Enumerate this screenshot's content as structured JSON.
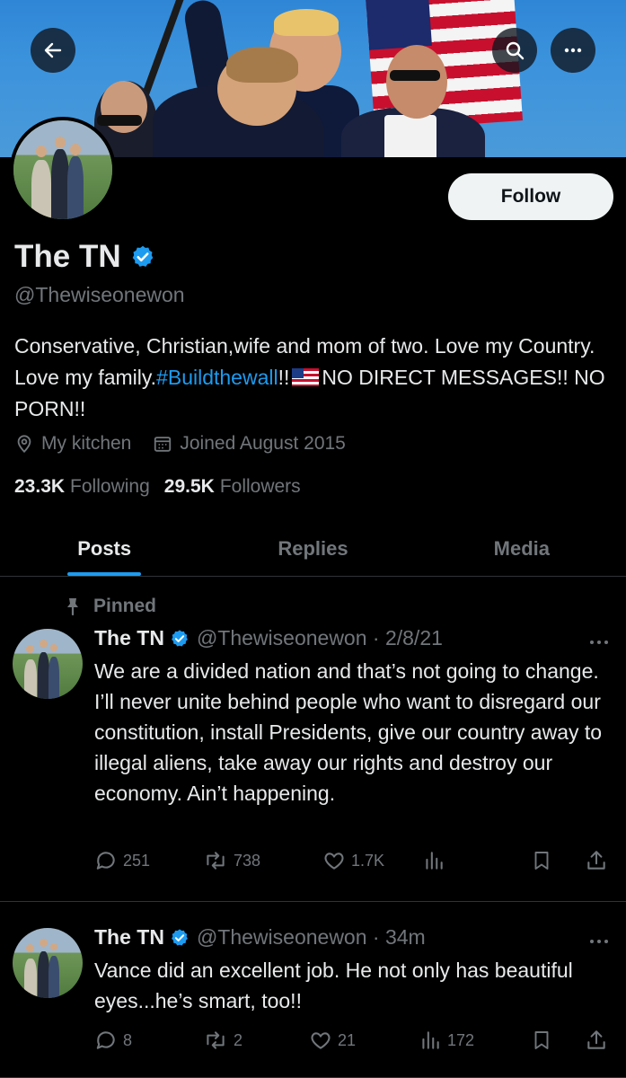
{
  "header": {
    "back_icon": "arrow-left-icon",
    "search_icon": "search-icon",
    "more_icon": "more-horizontal-icon"
  },
  "profile": {
    "follow_label": "Follow",
    "name": "The TN",
    "handle": "@Thewiseonewon",
    "bio_part1": "Conservative, Christian,wife and mom of two. Love my Country. Love my family.",
    "bio_hashtag": "#Buildthewall",
    "bio_part2": "!!",
    "bio_part3": "NO DIRECT MESSAGES!! NO PORN!!",
    "location": "My kitchen",
    "joined": "Joined August 2015",
    "following_count": "23.3K",
    "following_label": "Following",
    "followers_count": "29.5K",
    "followers_label": "Followers"
  },
  "tabs": [
    {
      "label": "Posts",
      "active": true
    },
    {
      "label": "Replies",
      "active": false
    },
    {
      "label": "Media",
      "active": false
    }
  ],
  "posts": [
    {
      "pinned_label": "Pinned",
      "name": "The TN",
      "handle_time": "@Thewiseonewon · 2/8/21",
      "text": "We are a divided nation and that’s not going to change.  I’ll never unite behind people who want to disregard our constitution, install Presidents, give our country away to illegal aliens, take away our rights and destroy our economy.  Ain’t happening.",
      "replies": "251",
      "reposts": "738",
      "likes": "1.7K",
      "views": ""
    },
    {
      "name": "The TN",
      "handle_time": "@Thewiseonewon · 34m",
      "text": "Vance did an excellent job.  He not only has beautiful eyes...he’s smart, too!!",
      "replies": "8",
      "reposts": "2",
      "likes": "21",
      "views": "172"
    }
  ],
  "colors": {
    "accent": "#1d9bf0",
    "background": "#000000",
    "muted": "#71767b",
    "text": "#e7e9ea"
  }
}
